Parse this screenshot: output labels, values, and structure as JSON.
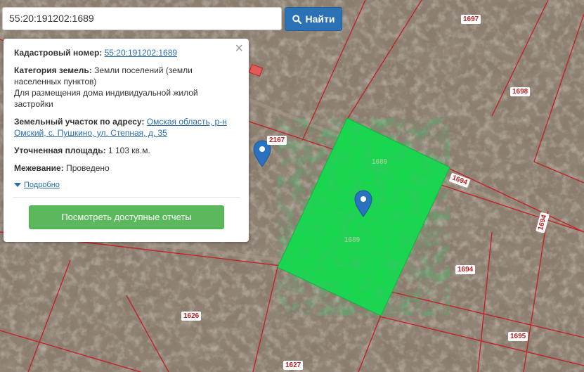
{
  "search": {
    "value": "55:20:191202:1689",
    "button_label": "Найти"
  },
  "info_panel": {
    "cadastral_label": "Кадастровый номер:",
    "cadastral_value": "55:20:191202:1689",
    "category_label": "Категория земель:",
    "category_value": "Земли поселений (земли населенных пунктов)",
    "purpose_text": "Для размещения дома индивидуальной жилой застройки",
    "address_label": "Земельный участок по адресу:",
    "address_value": "Омская область, р-н Омский, с. Пушкино, ул. Степная, д. 35",
    "area_label": "Уточненная площадь:",
    "area_value": "1 103 кв.м.",
    "survey_label": "Межевание:",
    "survey_value": "Проведено",
    "details_link": "Подробно",
    "close_glyph": "×",
    "report_button": "Посмотреть доступные отчеты"
  },
  "map": {
    "parcel_labels": [
      "1697",
      "1698",
      "2167",
      "1694",
      "1694",
      "1694",
      "1626",
      "1627",
      "1695"
    ],
    "selected_parcel_labels": [
      "1689",
      "1689"
    ],
    "selected_color": "#18d64e",
    "boundary_color": "#c0242a",
    "marker_color": "#2a72c0"
  }
}
